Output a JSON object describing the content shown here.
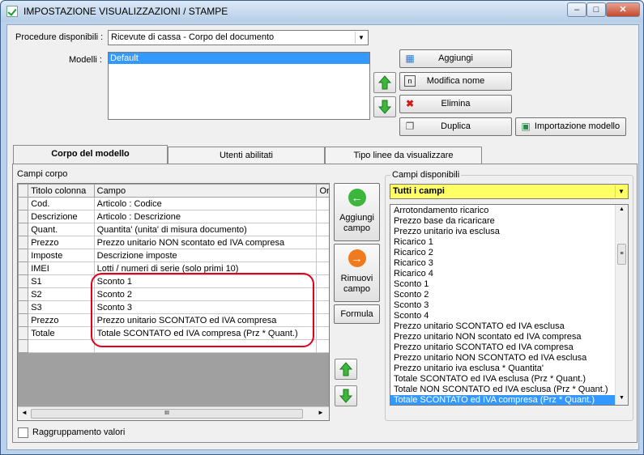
{
  "window": {
    "title": "IMPOSTAZIONE VISUALIZZAZIONI / STAMPE"
  },
  "top": {
    "procedure_label": "Procedure disponibili :",
    "procedure_value": "Ricevute di cassa - Corpo del documento",
    "modelli_label": "Modelli :",
    "modelli_items": [
      "Default"
    ],
    "buttons": {
      "aggiungi": "Aggiungi",
      "modifica": "Modifica nome",
      "elimina": "Elimina",
      "duplica": "Duplica",
      "importa": "Importazione modello"
    }
  },
  "tabs": [
    "Corpo del modello",
    "Utenti abilitati",
    "Tipo linee da visualizzare"
  ],
  "campi_corpo": {
    "label": "Campi corpo",
    "columns": [
      "Titolo colonna",
      "Campo",
      "Ord"
    ],
    "rows": [
      [
        "Cod.",
        "Articolo : Codice"
      ],
      [
        "Descrizione",
        "Articolo : Descrizione"
      ],
      [
        "Quant.",
        "Quantita' (unita' di misura documento)"
      ],
      [
        "Prezzo",
        "Prezzo unitario NON scontato ed IVA compresa"
      ],
      [
        "Imposte",
        "Descrizione imposte"
      ],
      [
        "IMEI",
        "Lotti / numeri di serie (solo primi 10)"
      ],
      [
        "S1",
        "Sconto 1"
      ],
      [
        "S2",
        "Sconto 2"
      ],
      [
        "S3",
        "Sconto 3"
      ],
      [
        "Prezzo",
        "Prezzo unitario SCONTATO ed IVA compresa"
      ],
      [
        "Totale",
        "Totale SCONTATO ed IVA compresa (Prz * Quant.)"
      ]
    ],
    "scroll_glyph": "III"
  },
  "middle_buttons": {
    "aggiungi_campo": "Aggiungi campo",
    "rimuovi_campo": "Rimuovi campo",
    "formula": "Formula"
  },
  "campi_disponibili": {
    "label": "Campi disponibili",
    "filter_value": "Tutti i campi",
    "items": [
      "Arrotondamento ricarico",
      "Prezzo base da ricaricare",
      "Prezzo unitario iva esclusa",
      "Ricarico 1",
      "Ricarico 2",
      "Ricarico 3",
      "Ricarico 4",
      "Sconto 1",
      "Sconto 2",
      "Sconto 3",
      "Sconto 4",
      "Prezzo unitario SCONTATO ed IVA esclusa",
      "Prezzo unitario NON scontato ed IVA compresa",
      "Prezzo unitario SCONTATO ed IVA compresa",
      "Prezzo unitario NON SCONTATO ed IVA esclusa",
      "Prezzo unitario iva esclusa * Quantita'",
      "Totale SCONTATO ed IVA esclusa (Prz * Quant.)",
      "Totale NON SCONTATO ed IVA esclusa (Prz * Quant.)",
      "Totale SCONTATO ed IVA compresa (Prz * Quant.)"
    ],
    "selected_index": 18
  },
  "footer": {
    "raggruppamento": "Raggruppamento valori"
  },
  "colors": {
    "accent": "#3399ff",
    "highlight_outline": "#e3001b",
    "filter_bg": "#ffff66"
  }
}
